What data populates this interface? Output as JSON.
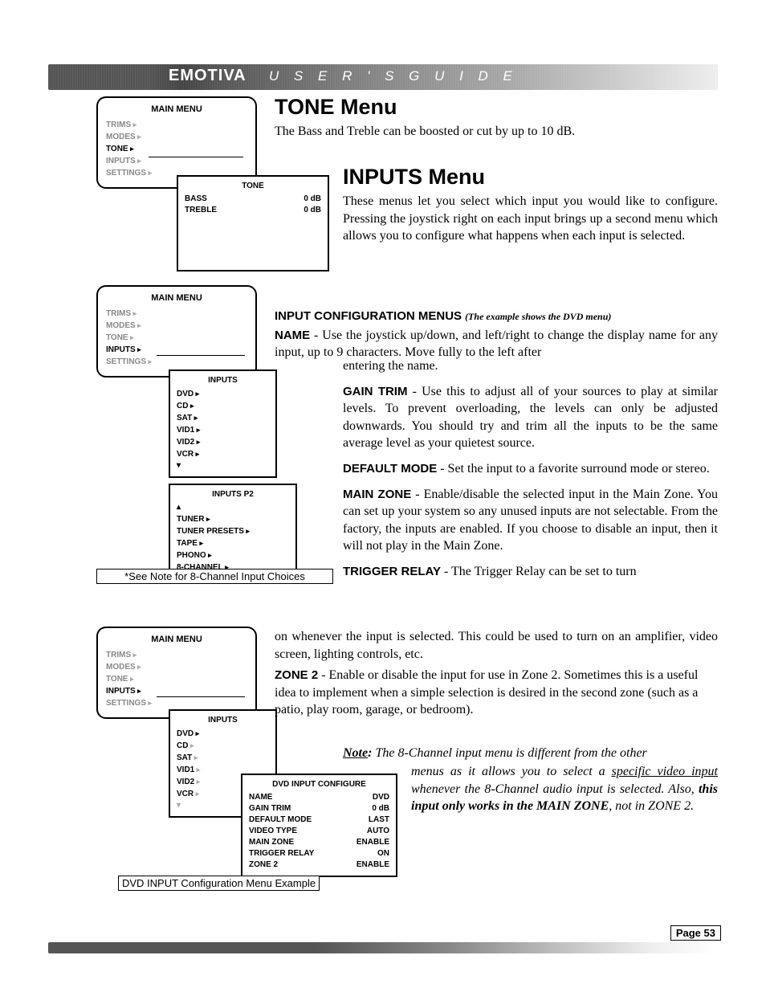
{
  "header": {
    "brand": "EMOTIVA",
    "subtitle": "U S E R ' S   G U I D E"
  },
  "footer": {
    "page_label": "Page 53"
  },
  "screens": {
    "main1": {
      "title": "MAIN MENU",
      "items": [
        "TRIMS",
        "MODES",
        "TONE",
        "INPUTS",
        "SETTINGS"
      ],
      "active": "TONE"
    },
    "tone_sub": {
      "title": "TONE",
      "rows": [
        {
          "label": "BASS",
          "value": "0 dB"
        },
        {
          "label": "TREBLE",
          "value": "0 dB"
        }
      ]
    },
    "main2": {
      "title": "MAIN MENU",
      "items": [
        "TRIMS",
        "MODES",
        "TONE",
        "INPUTS",
        "SETTINGS"
      ],
      "active": "INPUTS"
    },
    "inputs_sub": {
      "title": "INPUTS",
      "items": [
        "DVD",
        "CD",
        "SAT",
        "VID1",
        "VID2",
        "VCR"
      ]
    },
    "inputs_p2": {
      "title": "INPUTS P2",
      "items": [
        "TUNER",
        "TUNER PRESETS",
        "TAPE",
        "PHONO",
        "8-CHANNEL"
      ]
    },
    "note_8ch": "*See Note for 8-Channel Input Choices",
    "main3": {
      "title": "MAIN MENU",
      "items": [
        "TRIMS",
        "MODES",
        "TONE",
        "INPUTS",
        "SETTINGS"
      ],
      "active": "INPUTS"
    },
    "inputs_sub3": {
      "title": "INPUTS",
      "items": [
        "DVD",
        "CD",
        "SAT",
        "VID1",
        "VID2",
        "VCR"
      ]
    },
    "dvd_config": {
      "title": "DVD INPUT CONFIGURE",
      "rows": [
        {
          "label": "NAME",
          "value": "DVD"
        },
        {
          "label": "GAIN TRIM",
          "value": "0 dB"
        },
        {
          "label": "DEFAULT MODE",
          "value": "LAST"
        },
        {
          "label": "VIDEO TYPE",
          "value": "AUTO"
        },
        {
          "label": "MAIN ZONE",
          "value": "ENABLE"
        },
        {
          "label": "TRIGGER RELAY",
          "value": "ON"
        },
        {
          "label": "ZONE 2",
          "value": "ENABLE"
        }
      ]
    },
    "dvd_caption": "DVD INPUT Configuration Menu Example"
  },
  "text": {
    "tone_heading": "TONE Menu",
    "tone_body": "The Bass and Treble can be boosted or cut by up to 10 dB.",
    "inputs_heading": "INPUTS Menu",
    "inputs_body": "These menus let you select which input you would like to configure. Pressing the joystick right on each input brings up a second menu which allows you to configure what happens when each input is selected.",
    "config_heading": "INPUT CONFIGURATION MENUS",
    "config_heading_note": "(The example shows the DVD menu)",
    "name_label": "NAME",
    "name_body1": " - Use the joystick up/down, and left/right to change the display name for any input, up to 9 characters. Move fully to the left after ",
    "name_body2": "entering the name.",
    "gain_label": "GAIN TRIM",
    "gain_body": " - Use this to adjust all of your sources to play at similar levels. To prevent overloading, the levels can only be adjusted downwards. You should try and trim all the inputs to be the same average level as your quietest source.",
    "default_label": "DEFAULT MODE",
    "default_body": " - Set the input to a favorite surround mode or stereo.",
    "mainzone_label": "MAIN ZONE",
    "mainzone_body": " - Enable/disable the selected input in the Main Zone. You can set up your system so any unused inputs are not selectable. From the factory, the inputs are enabled. If you choose to disable an input, then it will not play in the Main Zone.",
    "trigger_label": "TRIGGER RELAY",
    "trigger_body1": " - The Trigger Relay can be set to turn ",
    "trigger_body2": "on whenever the input is selected. This could be used to turn on an amplifier, video screen, lighting controls, etc.",
    "zone2_label": "ZONE 2",
    "zone2_body": "  - Enable or disable the input for use in Zone 2. Sometimes this is a useful idea to implement when a simple selection is desired in the second zone (such as a patio, play room, garage, or bedroom).",
    "note_label": "Note",
    "note_colon": ":",
    "note_body1": " The 8-Channel input menu is different from the other ",
    "note_body2a": "menus as it allows you to select a ",
    "note_body2b": "specific video input",
    "note_body2c": " whenever the 8-Channel audio input is selected. Also, ",
    "note_body3": "this input only works in the MAIN ZONE",
    "note_body4": ", not in ZONE 2."
  }
}
